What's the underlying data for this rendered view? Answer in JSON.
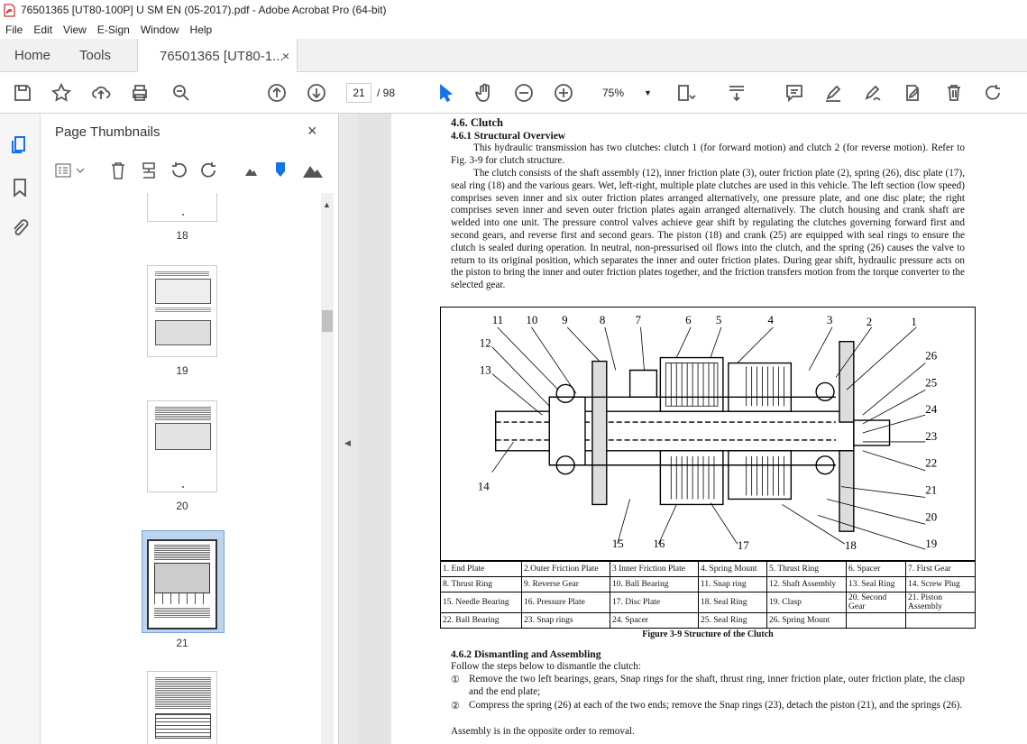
{
  "window": {
    "title": "76501365 [UT80-100P] U SM EN (05-2017).pdf - Adobe Acrobat Pro (64-bit)"
  },
  "menu": [
    "File",
    "Edit",
    "View",
    "E-Sign",
    "Window",
    "Help"
  ],
  "tabs": {
    "home": "Home",
    "tools": "Tools",
    "doc": "76501365 [UT80-1...",
    "close": "×"
  },
  "toolbar": {
    "page_current": "21",
    "page_total": "/ 98",
    "zoom": "75%"
  },
  "panel": {
    "title": "Page Thumbnails",
    "close": "×",
    "thumb_labels": [
      "18",
      "19",
      "20",
      "21"
    ]
  },
  "doc": {
    "h1": "4.6. Clutch",
    "h2": "4.6.1 Structural Overview",
    "p1": "This hydraulic transmission has two clutches: clutch 1 (for forward motion) and clutch 2 (for reverse motion). Refer to Fig. 3-9 for clutch structure.",
    "p2": "The clutch consists of the shaft assembly (12), inner friction plate (3), outer friction plate (2), spring (26), disc plate (17), seal ring (18) and the various gears. Wet, left-right, multiple plate clutches are used in this vehicle. The left section (low speed) comprises seven inner and six outer friction plates arranged alternatively, one pressure plate, and one disc plate; the right comprises seven inner and seven outer friction plates again arranged alternatively. The clutch housing and crank shaft are welded into one unit. The pressure control valves achieve gear shift by regulating the clutches governing forward first and second gears, and reverse first and second gears. The piston (18) and crank (25) are equipped with seal rings to ensure the clutch is sealed during operation. In neutral, non-pressurised oil flows into the clutch, and the spring (26) causes the valve to return to its original position, which separates the inner and outer friction plates. During gear shift, hydraulic pressure acts on the piston to bring the inner and outer friction plates together, and the friction transfers motion from the torque converter to the selected gear.",
    "fig_numbers_top": [
      "11",
      "10",
      "9",
      "8",
      "7",
      "6",
      "5",
      "4",
      "3",
      "2",
      "1"
    ],
    "fig_numbers_right": [
      "26",
      "25",
      "24",
      "23",
      "22",
      "21",
      "20",
      "19"
    ],
    "fig_numbers_left": [
      "12",
      "13",
      "14"
    ],
    "fig_numbers_bottom": [
      "15",
      "16",
      "17",
      "18"
    ],
    "legend": [
      [
        "1. End Plate",
        "2.Outer Friction Plate",
        "3 Inner Friction Plate",
        "4. Spring Mount",
        "5. Thrust Ring",
        "6. Spacer",
        "7. First Gear"
      ],
      [
        "8. Thrust Ring",
        "9. Reverse Gear",
        "10. Ball Bearing",
        "11. Snap ring",
        "12. Shaft Assembly",
        "13. Seal Ring",
        "14. Screw Plug"
      ],
      [
        "15. Needle Bearing",
        "16. Pressure Plate",
        "17. Disc Plate",
        "18. Seal Ring",
        "19. Clasp",
        "20. Second Gear",
        "21. Piston Assembly"
      ],
      [
        "22. Ball Bearing",
        "23. Snap rings",
        "24. Spacer",
        "25. Seal Ring",
        "26. Spring Mount",
        "",
        ""
      ]
    ],
    "caption": "Figure 3-9 Structure of the Clutch",
    "h3": "4.6.2 Dismantling and Assembling",
    "intro": "Follow the steps below to dismantle the clutch:",
    "step1_num": "①",
    "step1": "Remove the two left bearings, gears, Snap rings for the shaft, thrust ring, inner friction plate, outer friction plate, the clasp and the end plate;",
    "step2_num": "②",
    "step2": "Compress the spring (26) at each of the two ends; remove the Snap rings (23), detach the piston (21), and the springs (26).",
    "outro": "Assembly is in the opposite order to removal."
  }
}
